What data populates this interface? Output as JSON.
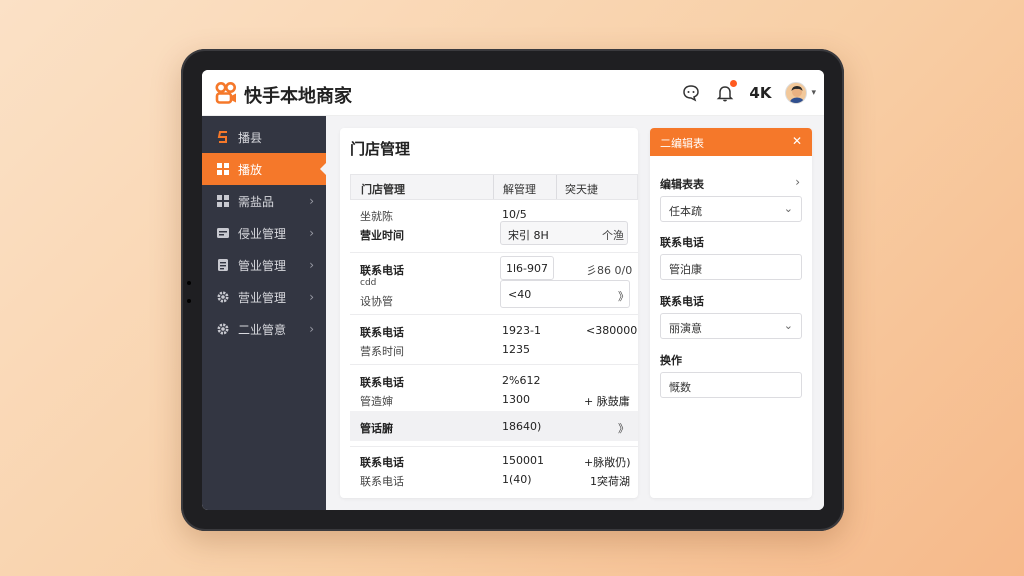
{
  "app": {
    "brand": "快手本地商家",
    "header_text": "4K"
  },
  "sidebar": {
    "items": [
      {
        "label": "播县",
        "icon": "brand-s-icon"
      },
      {
        "label": "播放",
        "icon": "grid-icon"
      },
      {
        "label": "需盐品",
        "icon": "apps-icon"
      },
      {
        "label": "侵业管理",
        "icon": "card-icon"
      },
      {
        "label": "管业管理",
        "icon": "document-icon"
      },
      {
        "label": "营业管理",
        "icon": "gear-icon"
      },
      {
        "label": "二业管意",
        "icon": "settings-icon"
      }
    ]
  },
  "main": {
    "title": "门店管理",
    "table": {
      "headers": [
        "门店管理",
        "解管理",
        "突天捷"
      ],
      "rows": [
        {
          "a": "坐就陈",
          "b": "10/5"
        },
        {
          "a": "营业时间",
          "b": "宋引 8H",
          "c": "个渔"
        },
        {
          "a": "联系电话",
          "b": "1l6-907",
          "c": "彡86 0/0"
        },
        {
          "a": "cdd",
          "a2": "设协管",
          "b": "<40",
          "c": "》"
        },
        {
          "a": "联系电话",
          "a2": "营系时间",
          "b": "1923-1",
          "b2": "1235",
          "c": "<380000"
        },
        {
          "a": "联系电话",
          "a2": "管造婶",
          "b": "2%612",
          "b2": "1300",
          "c": "+ 脉鼓庸"
        },
        {
          "a": "管话腑",
          "b": "18640)",
          "c": "》"
        },
        {
          "a": "联系电话",
          "a2": "联系电话",
          "b": "150001",
          "b2": "1(40)",
          "c": "+脉敞仍)",
          "c2": "1突荷湖"
        }
      ]
    }
  },
  "panel": {
    "title": "二编辑表",
    "close": "✕",
    "sections": [
      {
        "label": "编辑表表",
        "value": "任本疏",
        "type": "select"
      },
      {
        "label": "联系电话",
        "value": "管泊康",
        "type": "text"
      },
      {
        "label": "联系电话",
        "value": "丽演意",
        "type": "select"
      },
      {
        "label": "换作",
        "value": "慨数",
        "type": "text"
      }
    ]
  },
  "colors": {
    "accent": "#f5782a",
    "sidebar_bg": "#333642",
    "notification_dot": "#ff5a1f"
  }
}
